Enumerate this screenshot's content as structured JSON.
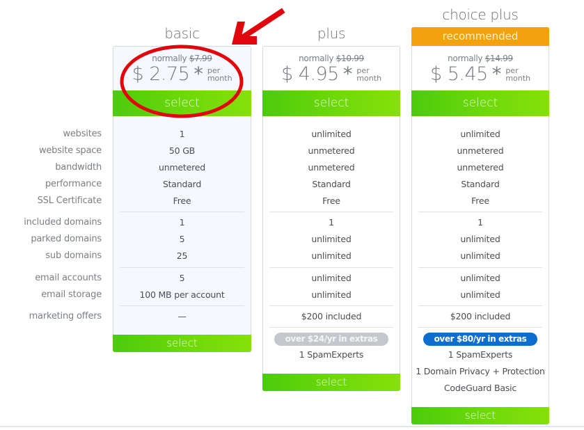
{
  "feature_labels": [
    "websites",
    "website space",
    "bandwidth",
    "performance",
    "SSL Certificate",
    "included domains",
    "parked domains",
    "sub domains",
    "email accounts",
    "email storage",
    "marketing offers"
  ],
  "plans": [
    {
      "name": "basic",
      "normally_label": "normally",
      "old_price": "$7.99",
      "price": "$ 2.75",
      "asterisk": "*",
      "per": "per",
      "month": "month",
      "select_label": "select",
      "features": [
        "1",
        "50 GB",
        "unmetered",
        "Standard",
        "Free",
        "1",
        "5",
        "25",
        "5",
        "100 MB per account",
        "—"
      ],
      "bottom_select_label": "select"
    },
    {
      "name": "plus",
      "normally_label": "normally",
      "old_price": "$10.99",
      "price": "$ 4.95",
      "asterisk": "*",
      "per": "per",
      "month": "month",
      "select_label": "select",
      "features": [
        "unlimited",
        "unmetered",
        "unmetered",
        "Standard",
        "Free",
        "1",
        "unlimited",
        "unlimited",
        "unlimited",
        "unlimited",
        "$200 included"
      ],
      "extras_badge": "over $24/yr in extras",
      "extras": [
        "1 SpamExperts"
      ],
      "bottom_select_label": "select"
    },
    {
      "name": "choice plus",
      "badge": "recommended",
      "normally_label": "normally",
      "old_price": "$14.99",
      "price": "$ 5.45",
      "asterisk": "*",
      "per": "per",
      "month": "month",
      "select_label": "select",
      "features": [
        "unlimited",
        "unmetered",
        "unmetered",
        "Standard",
        "Free",
        "1",
        "unlimited",
        "unlimited",
        "unlimited",
        "unlimited",
        "$200 included"
      ],
      "extras_badge": "over $80/yr in extras",
      "extras": [
        "1 SpamExperts",
        "1 Domain Privacy + Protection",
        "CodeGuard Basic"
      ],
      "bottom_select_label": "select"
    }
  ],
  "colors": {
    "select_green": "#6fd90a",
    "recommended_orange": "#f2a20c",
    "extras_blue": "#0e6ecf",
    "extras_grey": "#c4c7cb",
    "annotation_red": "#e0060c"
  },
  "annotations": {
    "arrow_icon": "red-arrow-pointing-to-basic-price",
    "circle_icon": "red-circle-around-basic-price"
  }
}
